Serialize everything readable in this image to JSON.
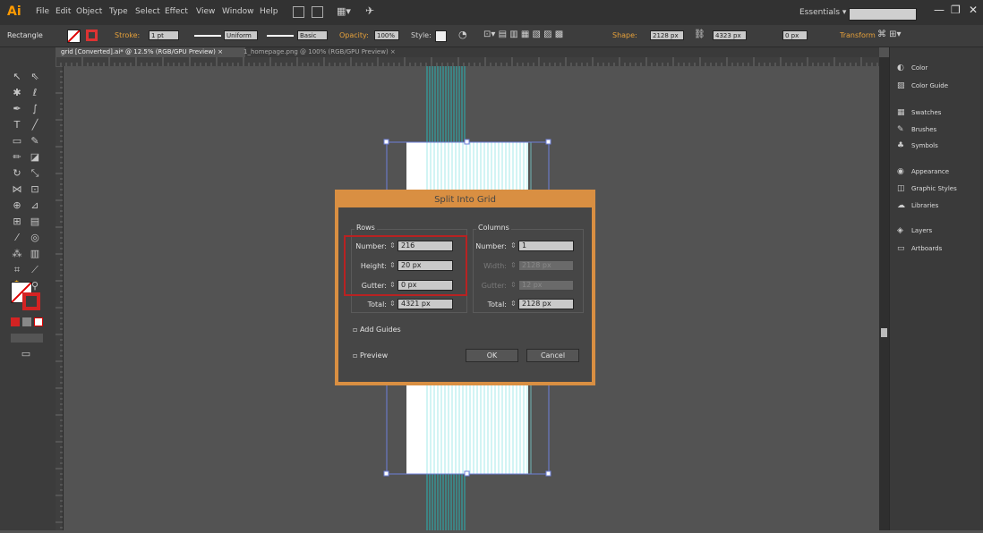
{
  "app": {
    "logo": "Ai",
    "menu": [
      "File",
      "Edit",
      "Object",
      "Type",
      "Select",
      "Effect",
      "View",
      "Window",
      "Help"
    ],
    "workspace": "Essentials",
    "window_buttons": [
      "—",
      "❐",
      "✕"
    ]
  },
  "control_bar": {
    "object_type": "Rectangle",
    "stroke_label": "Stroke:",
    "stroke_value": "1 pt",
    "profile_value": "Uniform",
    "brush_value": "Basic",
    "opacity_label": "Opacity:",
    "opacity_value": "100%",
    "style_label": "Style:",
    "shape_label": "Shape:",
    "width_value": "2128 px",
    "height_value": "4323 px",
    "corner_value": "0 px",
    "transform_label": "Transform"
  },
  "tabs": [
    {
      "label": "grid [Converted].ai* @ 12.5% (RGB/GPU Preview)",
      "close": "×"
    },
    {
      "label": "1_homepage.png @ 100% (RGB/GPU Preview)",
      "close": "×"
    }
  ],
  "right_panel": {
    "items": [
      {
        "label": "Color",
        "icon": "color-icon",
        "glyph": "◐"
      },
      {
        "label": "Color Guide",
        "icon": "color-guide-icon",
        "glyph": "▨"
      },
      {
        "label": "Swatches",
        "icon": "swatches-icon",
        "glyph": "▦"
      },
      {
        "label": "Brushes",
        "icon": "brushes-icon",
        "glyph": "✎"
      },
      {
        "label": "Symbols",
        "icon": "symbols-icon",
        "glyph": "♣"
      },
      {
        "label": "Appearance",
        "icon": "appearance-icon",
        "glyph": "◉"
      },
      {
        "label": "Graphic Styles",
        "icon": "graphic-styles-icon",
        "glyph": "◫"
      },
      {
        "label": "Libraries",
        "icon": "libraries-icon",
        "glyph": "☁"
      },
      {
        "label": "Layers",
        "icon": "layers-icon",
        "glyph": "◈"
      },
      {
        "label": "Artboards",
        "icon": "artboards-icon",
        "glyph": "▭"
      }
    ]
  },
  "dialog": {
    "title": "Split Into Grid",
    "rows": {
      "heading": "Rows",
      "number_label": "Number:",
      "number_value": "216",
      "height_label": "Height:",
      "height_value": "20 px",
      "gutter_label": "Gutter:",
      "gutter_value": "0 px",
      "total_label": "Total:",
      "total_value": "4321 px"
    },
    "columns": {
      "heading": "Columns",
      "number_label": "Number:",
      "number_value": "1",
      "width_label": "Width:",
      "width_value": "2128 px",
      "gutter_label": "Gutter:",
      "gutter_value": "12 px",
      "total_label": "Total:",
      "total_value": "2128 px"
    },
    "add_guides_label": "Add Guides",
    "preview_label": "Preview",
    "ok_label": "OK",
    "cancel_label": "Cancel"
  },
  "colors": {
    "accent": "#d98f42",
    "highlight": "#b82222",
    "grid_line": "#2ab3b3"
  }
}
